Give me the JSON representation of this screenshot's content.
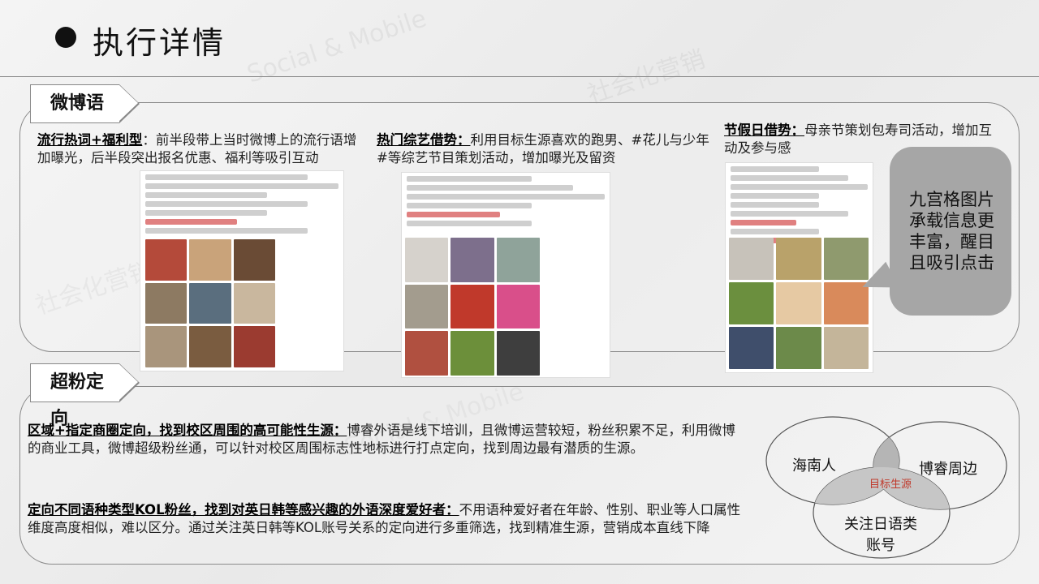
{
  "header": {
    "title": "执行详情"
  },
  "watermarks": [
    "Social & Mobile",
    "社会化营销",
    "Social & Mobile",
    "社会化营销"
  ],
  "weibo_section": {
    "tag": "微博语",
    "col1": {
      "heading": "流行热词+福利型",
      "sep": "：",
      "text": "前半段带上当时微博上的流行语增加曝光，后半段突出报名优惠、福利等吸引互动"
    },
    "col2": {
      "heading": "热门综艺借势：",
      "text": "利用目标生源喜欢的跑男、#花儿与少年#等综艺节目策划活动，增加曝光及留资"
    },
    "col3": {
      "heading": "节假日借势：",
      "text": "母亲节策划包寿司活动，增加互动及参与感"
    },
    "callout": "九宫格图片承载信息更丰富，醒目且吸引点击"
  },
  "fans_section": {
    "tag": "超粉定向",
    "p1": {
      "heading": "区域+指定商圈定向，找到校区周围的高可能性生源：",
      "text": "博睿外语是线下培训，且微博运营较短，粉丝积累不足，利用微博的商业工具，微博超级粉丝通，可以针对校区周围标志性地标进行打点定向，找到周边最有潜质的生源。"
    },
    "p2": {
      "heading": "定向不同语种类型KOL粉丝，找到对英日韩等感兴趣的外语深度爱好者：",
      "text": "不用语种爱好者在年龄、性别、职业等人口属性维度高度相似，难以区分。通过关注英日韩等KOL账号关系的定向进行多重筛选，找到精准生源，营销成本直线下降"
    }
  },
  "venn": {
    "a": "海南人",
    "b": "博睿周边",
    "c_line1": "关注日语类",
    "c_line2": "账号",
    "center": "目标生源"
  },
  "colors": {
    "callout_bg": "#a6a6a6",
    "venn_overlap": "#b5b5b5",
    "target_text": "#c0392b"
  }
}
